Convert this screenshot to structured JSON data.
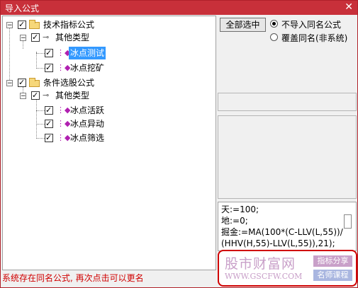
{
  "window": {
    "title": "导入公式",
    "close": "✕"
  },
  "tree": [
    {
      "label": "技术指标公式"
    },
    {
      "label": "其他类型"
    },
    {
      "label": "冰点测试",
      "selected": true
    },
    {
      "label": "冰点挖矿"
    },
    {
      "label": "条件选股公式"
    },
    {
      "label": "其他类型"
    },
    {
      "label": "冰点活跃"
    },
    {
      "label": "冰点异动"
    },
    {
      "label": "冰点筛选"
    }
  ],
  "actions": {
    "select_all": "全部选中",
    "radio_skip": "不导入同名公式",
    "radio_overwrite": "覆盖同名(非系统)",
    "selected_radio": "radio_skip"
  },
  "code_lines": [
    "天:=100;",
    "地:=0;",
    "掘金:=MA(100*(C-LLV(L,55))/",
    "(HHV(H,55)-LLV(L,55)),21);"
  ],
  "status": "系统存在同名公式, 再次点击可以更名",
  "watermark": {
    "title": "股市财富网",
    "url": "WWW.GSCFW.COM",
    "tag1": "指标分享",
    "tag2": "名师课程"
  },
  "colors": {
    "titlebar": "#c8303a",
    "status_text": "#d00000",
    "selection": "#3399ff"
  }
}
